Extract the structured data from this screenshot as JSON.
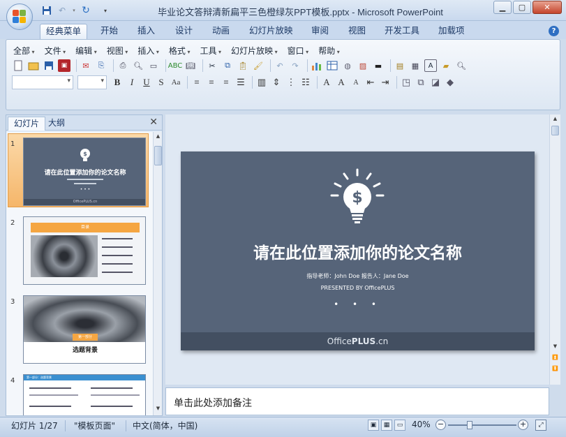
{
  "window": {
    "title": "毕业论文答辩清新扁平三色橙绿灰PPT模板.pptx - Microsoft PowerPoint"
  },
  "ribbon_tabs": [
    "经典菜单",
    "开始",
    "插入",
    "设计",
    "动画",
    "幻灯片放映",
    "审阅",
    "视图",
    "开发工具",
    "加载项"
  ],
  "active_tab": "经典菜单",
  "classic_menu": [
    "全部",
    "文件",
    "编辑",
    "视图",
    "插入",
    "格式",
    "工具",
    "幻灯片放映",
    "窗口",
    "帮助"
  ],
  "panel": {
    "tabs": [
      "幻灯片",
      "大纲"
    ],
    "active_tab": "幻灯片"
  },
  "thumbnails": [
    {
      "number": "1",
      "title": "请在此位置添加你的论文名称",
      "footer": "OfficePLUS.cn"
    },
    {
      "number": "2",
      "heading": "目录"
    },
    {
      "number": "3",
      "banner": "第一部分",
      "caption": "选题背景"
    },
    {
      "number": "4",
      "heading": "第一部分：选题背景"
    }
  ],
  "slide": {
    "title": "请在此位置添加你的论文名称",
    "advisor_line": "指导老师：John  Doe  报告人：Jane  Doe",
    "presented_line": "PRESENTED  BY  OfficePLUS",
    "dots": "• • •",
    "brand_prefix": "Office",
    "brand_bold": "PLUS",
    "brand_suffix": ".cn",
    "background_color": "#566479",
    "footer_color": "#434f61"
  },
  "notes": {
    "placeholder": "单击此处添加备注"
  },
  "status": {
    "slide_counter": "幻灯片 1/27",
    "template": "\"模板页面\"",
    "language": "中文(简体，中国)",
    "zoom": "40%",
    "zoom_fraction": 0.3
  },
  "colors": {
    "accent_orange": "#f5a642",
    "selection": "#f5b66a"
  }
}
